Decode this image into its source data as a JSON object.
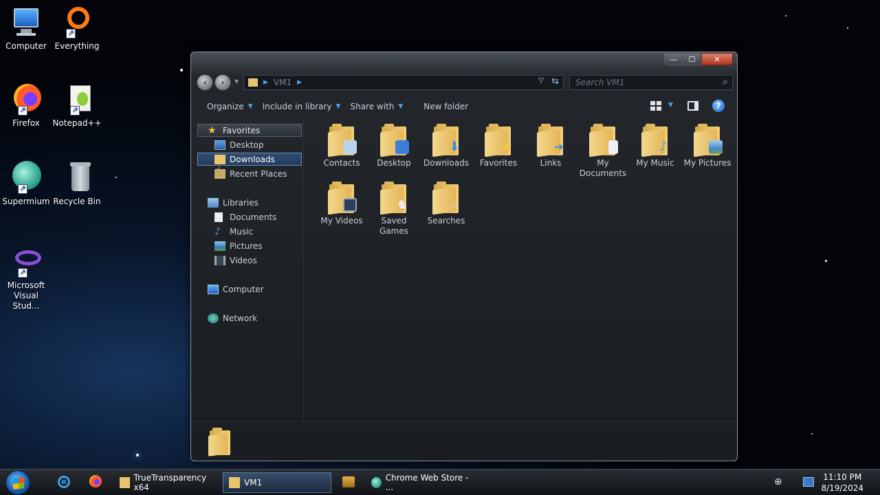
{
  "desktop": {
    "icons": [
      {
        "label": "Computer"
      },
      {
        "label": "Everything"
      },
      {
        "label": "Firefox"
      },
      {
        "label": "Notepad++"
      },
      {
        "label": "Supermium"
      },
      {
        "label": "Recycle Bin"
      },
      {
        "label": "Microsoft Visual Stud..."
      }
    ]
  },
  "window": {
    "controls": {
      "minimize": "—",
      "maximize": "☐",
      "close": "✕"
    },
    "address": {
      "path": "VM1"
    },
    "search": {
      "placeholder": "Search VM1"
    },
    "toolbar": {
      "organize": "Organize",
      "include_in_library": "Include in library",
      "share_with": "Share with",
      "new_folder": "New folder"
    },
    "nav_pane": {
      "favorites": "Favorites",
      "desktop": "Desktop",
      "downloads": "Downloads",
      "recent_places": "Recent Places",
      "libraries": "Libraries",
      "documents": "Documents",
      "music": "Music",
      "pictures": "Pictures",
      "videos": "Videos",
      "computer": "Computer",
      "network": "Network"
    },
    "items": [
      {
        "label": "Contacts"
      },
      {
        "label": "Desktop"
      },
      {
        "label": "Downloads"
      },
      {
        "label": "Favorites"
      },
      {
        "label": "Links"
      },
      {
        "label": "My Documents"
      },
      {
        "label": "My Music"
      },
      {
        "label": "My Pictures"
      },
      {
        "label": "My Videos"
      },
      {
        "label": "Saved Games"
      },
      {
        "label": "Searches"
      }
    ]
  },
  "taskbar": {
    "apps": [
      {
        "label": "TrueTransparency x64"
      },
      {
        "label": "VM1"
      },
      {
        "label": "Chrome Web Store - ..."
      }
    ],
    "clock": {
      "time": "11:10 PM",
      "date": "8/19/2024"
    }
  },
  "colors": {
    "accent": "#4aa3e8",
    "folder": "#f2cf7a",
    "selection": "#2e4d73"
  }
}
